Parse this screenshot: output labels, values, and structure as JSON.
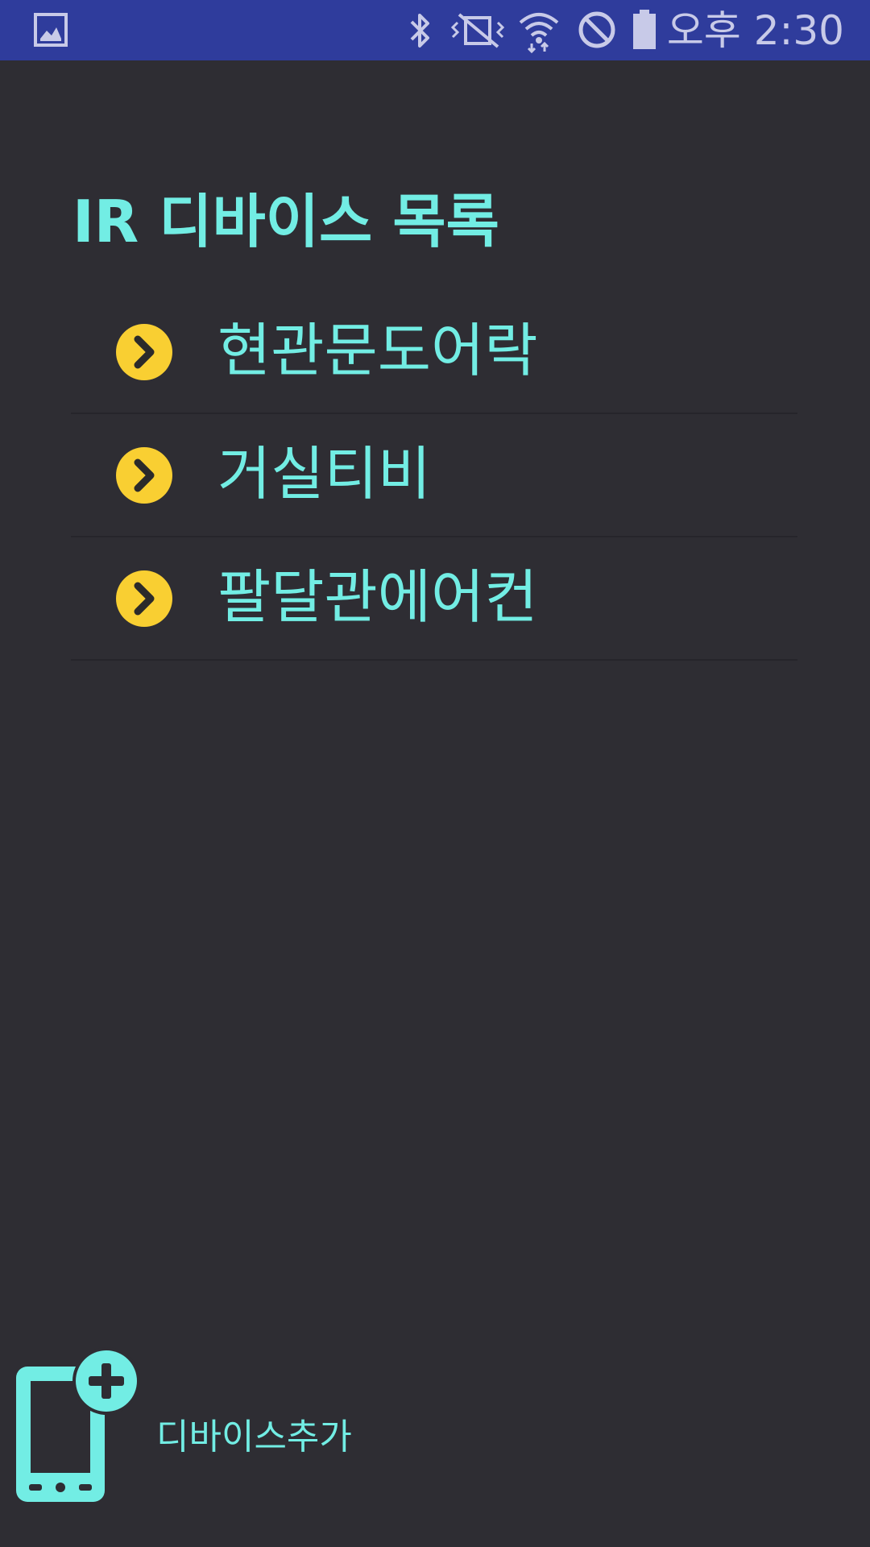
{
  "status_bar": {
    "time": "오후 2:30",
    "background_color": "#2f3c9c",
    "icons": [
      "image-notification-icon",
      "bluetooth-icon",
      "vibrate-icon",
      "wifi-icon",
      "do-not-disturb-icon",
      "battery-icon"
    ]
  },
  "page": {
    "title": "IR 디바이스 목록",
    "background_color": "#2e2d33",
    "accent_color": "#72ede4",
    "arrow_color": "#f9cf32"
  },
  "devices": [
    {
      "label": "현관문도어락",
      "icon": "chevron-right-circle-icon"
    },
    {
      "label": "거실티비",
      "icon": "chevron-right-circle-icon"
    },
    {
      "label": "팔달관에어컨",
      "icon": "chevron-right-circle-icon"
    }
  ],
  "add_device": {
    "label": "디바이스추가",
    "icon": "phone-add-icon"
  }
}
